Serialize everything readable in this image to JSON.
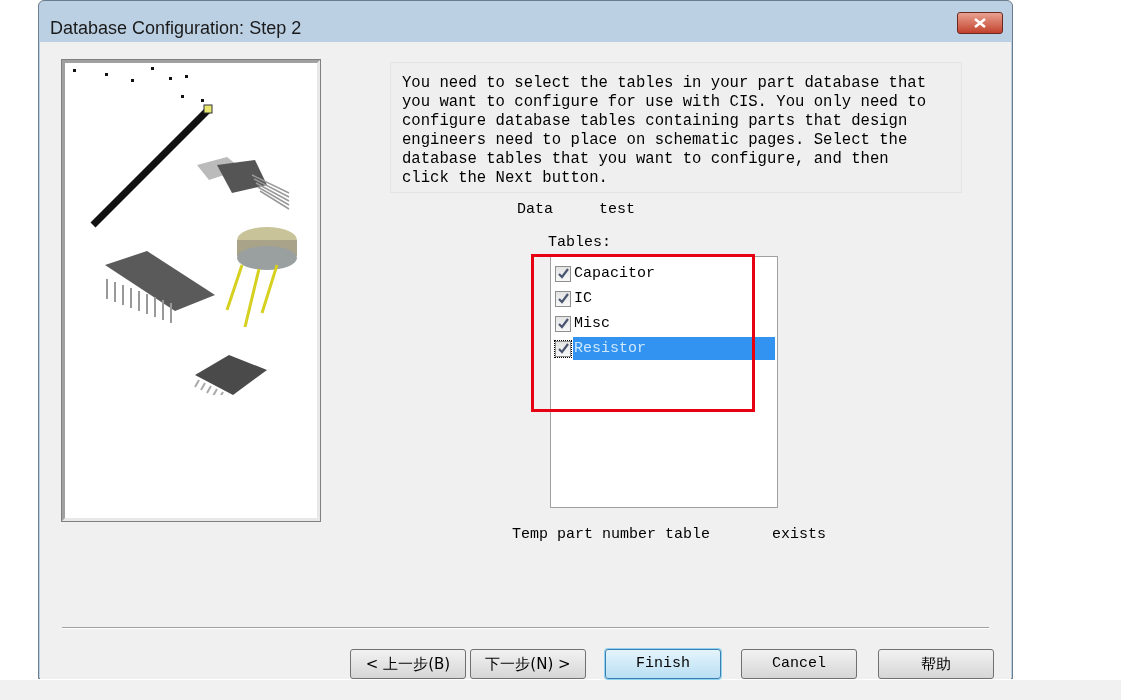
{
  "window": {
    "title": "Database Configuration: Step 2"
  },
  "description": "You need to select the tables in your part database that you want to configure for use with CIS. You only need to configure database tables containing parts that design engineers need to place on schematic pages. Select the database tables that you want to configure, and then click the Next button.",
  "data_source": {
    "label": "Data",
    "value": "test"
  },
  "tables_label": "Tables:",
  "tables": [
    {
      "label": "Capacitor",
      "checked": true,
      "selected": false
    },
    {
      "label": "IC",
      "checked": true,
      "selected": false
    },
    {
      "label": "Misc",
      "checked": true,
      "selected": false
    },
    {
      "label": "Resistor",
      "checked": true,
      "selected": true
    }
  ],
  "temp_table": {
    "label": "Temp part number table",
    "status": "exists"
  },
  "buttons": [
    {
      "label": "< 上一步(B)",
      "default": false
    },
    {
      "label": "下一步(N) >",
      "default": false
    },
    {
      "label": "Finish",
      "default": true
    },
    {
      "label": "Cancel",
      "default": false
    },
    {
      "label": "帮助",
      "default": false
    }
  ]
}
